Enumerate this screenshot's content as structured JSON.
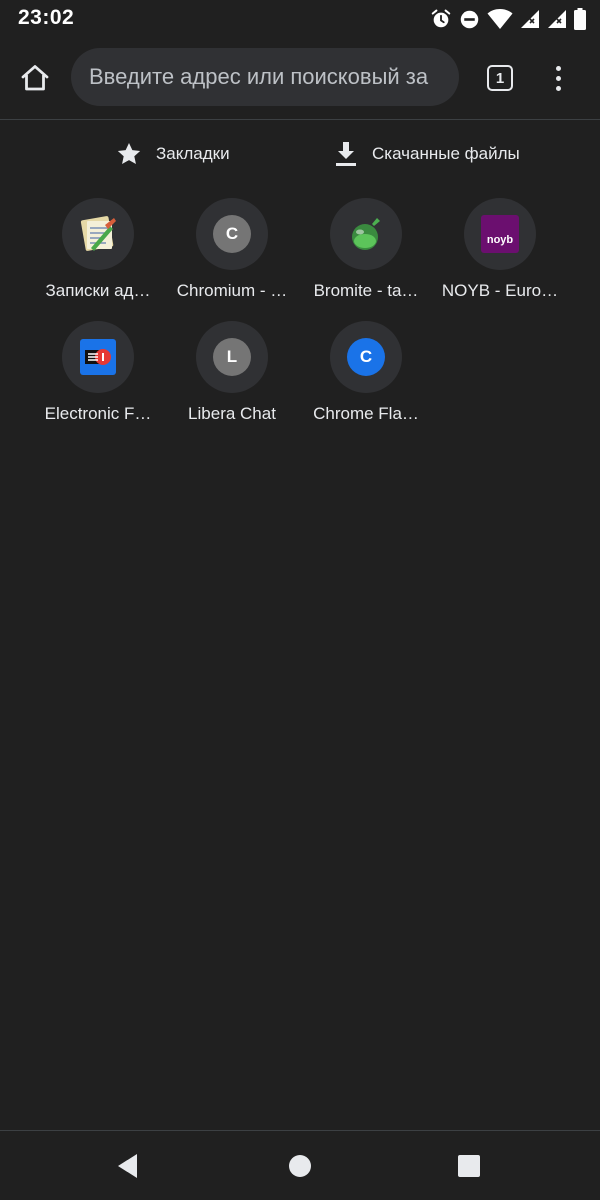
{
  "status_bar": {
    "time": "23:02",
    "icons": [
      "alarm-icon",
      "do-not-disturb-icon",
      "wifi-icon",
      "cellular-icon",
      "cellular-icon",
      "battery-icon"
    ]
  },
  "toolbar": {
    "omnibox_placeholder": "Введите адрес или поисковый за",
    "tab_count": "1"
  },
  "quick_actions": {
    "bookmarks_label": "Закладки",
    "downloads_label": "Скачанные файлы"
  },
  "tiles": [
    {
      "title": "Записки ад…",
      "icon": "notepad-icon"
    },
    {
      "title": "Chromium - …",
      "icon": "letter-icon",
      "letter": "C",
      "color": "#757575"
    },
    {
      "title": "Bromite - ta…",
      "icon": "bromite-icon"
    },
    {
      "title": "NOYB - Euro…",
      "icon": "noyb-icon",
      "badge": "noyb",
      "color": "#6b0f6f"
    },
    {
      "title": "Electronic F…",
      "icon": "eff-icon",
      "color": "#1a73e8"
    },
    {
      "title": "Libera Chat",
      "icon": "letter-icon",
      "letter": "L",
      "color": "#757575"
    },
    {
      "title": "Chrome Fla…",
      "icon": "letter-icon",
      "letter": "C",
      "color": "#1a73e8"
    }
  ],
  "colors": {
    "background": "#202020",
    "omnibox": "#303134",
    "tile_circle": "#303134",
    "text": "#e8eaed"
  }
}
